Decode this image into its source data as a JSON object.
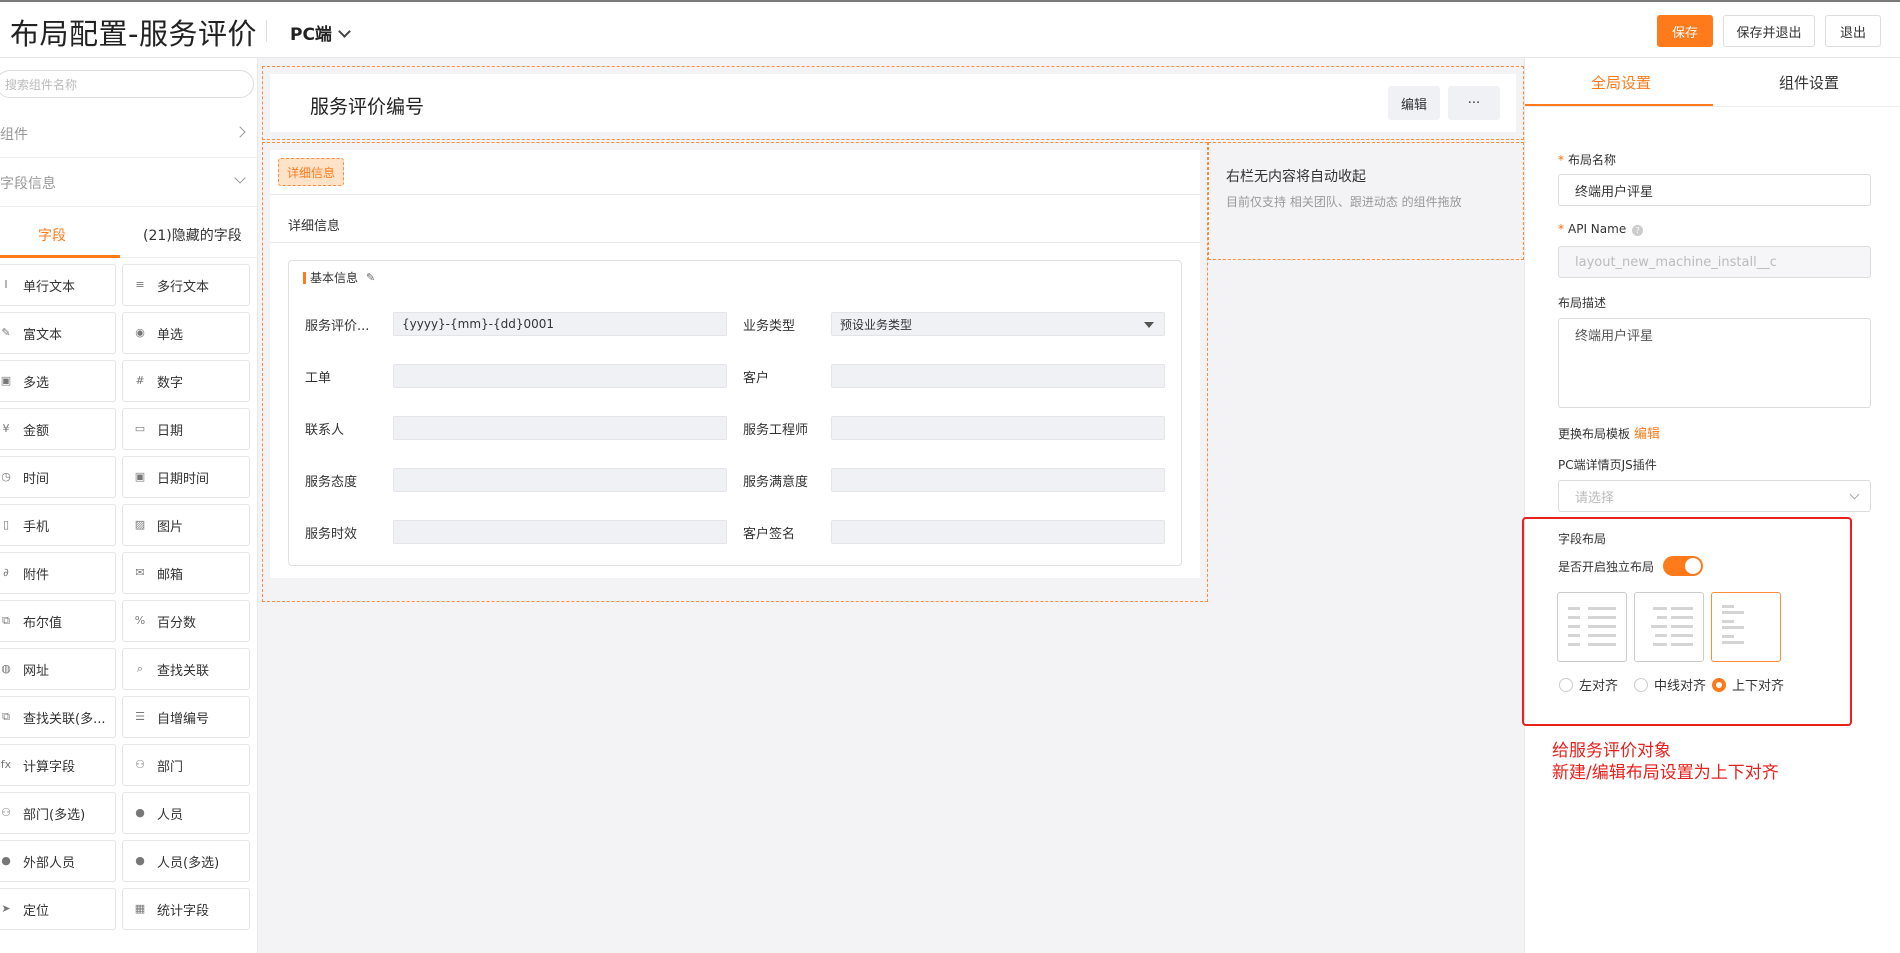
{
  "header": {
    "title": "布局配置-服务评价",
    "platform": "PC端",
    "save_label": "保存",
    "save_exit_label": "保存并退出",
    "exit_label": "退出"
  },
  "left": {
    "search_placeholder": "搜索组件名称",
    "components_label": "组件",
    "field_info_label": "字段信息",
    "tab_fields": "字段",
    "tab_hidden": "(21)隐藏的字段",
    "fields": [
      {
        "label": "单行文本",
        "icon": "text-icon"
      },
      {
        "label": "多行文本",
        "icon": "multiline-icon"
      },
      {
        "label": "富文本",
        "icon": "rich-text-icon"
      },
      {
        "label": "单选",
        "icon": "radio-icon"
      },
      {
        "label": "多选",
        "icon": "checkbox-icon"
      },
      {
        "label": "数字",
        "icon": "hash-icon"
      },
      {
        "label": "金额",
        "icon": "yen-icon"
      },
      {
        "label": "日期",
        "icon": "calendar-icon"
      },
      {
        "label": "时间",
        "icon": "clock-icon"
      },
      {
        "label": "日期时间",
        "icon": "datetime-icon"
      },
      {
        "label": "手机",
        "icon": "phone-icon"
      },
      {
        "label": "图片",
        "icon": "image-icon"
      },
      {
        "label": "附件",
        "icon": "paperclip-icon"
      },
      {
        "label": "邮箱",
        "icon": "mail-icon"
      },
      {
        "label": "布尔值",
        "icon": "boolean-icon"
      },
      {
        "label": "百分数",
        "icon": "percent-icon"
      },
      {
        "label": "网址",
        "icon": "globe-icon"
      },
      {
        "label": "查找关联",
        "icon": "lookup-icon"
      },
      {
        "label": "查找关联(多...",
        "icon": "lookup-multi-icon"
      },
      {
        "label": "自增编号",
        "icon": "list-number-icon"
      },
      {
        "label": "计算字段",
        "icon": "fx-icon"
      },
      {
        "label": "部门",
        "icon": "department-icon"
      },
      {
        "label": "部门(多选)",
        "icon": "department-multi-icon"
      },
      {
        "label": "人员",
        "icon": "person-icon"
      },
      {
        "label": "外部人员",
        "icon": "external-person-icon"
      },
      {
        "label": "人员(多选)",
        "icon": "person-multi-icon"
      },
      {
        "label": "定位",
        "icon": "location-icon"
      },
      {
        "label": "统计字段",
        "icon": "stats-icon"
      }
    ]
  },
  "canvas": {
    "object_title": "服务评价编号",
    "edit_label": "编辑",
    "more_label": "···",
    "detail_tag": "详细信息",
    "detail_sub": "详细信息",
    "group_title": "基本信息",
    "right_empty_title": "右栏无内容将自动收起",
    "right_empty_desc": "目前仅支持 相关团队、跟进动态 的组件拖放",
    "rows": [
      {
        "l_label": "服务评价...",
        "l_value": "{yyyy}-{mm}-{dd}0001",
        "r_label": "业务类型",
        "r_value": "预设业务类型"
      },
      {
        "l_label": "工单",
        "l_value": "",
        "r_label": "客户",
        "r_value": ""
      },
      {
        "l_label": "联系人",
        "l_value": "",
        "r_label": "服务工程师",
        "r_value": ""
      },
      {
        "l_label": "服务态度",
        "l_value": "",
        "r_label": "服务满意度",
        "r_value": ""
      },
      {
        "l_label": "服务时效",
        "l_value": "",
        "r_label": "客户签名",
        "r_value": ""
      }
    ]
  },
  "right": {
    "tab_global": "全局设置",
    "tab_component": "组件设置",
    "layout_name_label": "布局名称",
    "layout_name_value": "终端用户评星",
    "api_name_label": "API Name",
    "api_name_value": "layout_new_machine_install__c",
    "desc_label": "布局描述",
    "desc_value": "终端用户评星",
    "template_label": "更换布局模板",
    "template_edit": "编辑",
    "js_plugin_label": "PC端详情页JS插件",
    "js_plugin_placeholder": "请选择",
    "field_layout_label": "字段布局",
    "independent_label": "是否开启独立布局",
    "independent_on": true,
    "align_left": "左对齐",
    "align_center": "中线对齐",
    "align_top": "上下对齐",
    "selected_align": "上下对齐"
  },
  "annotation": {
    "line1": "给服务评价对象",
    "line2": "新建/编辑布局设置为上下对齐"
  },
  "colors": {
    "accent": "#ff7a1a",
    "annotation_red": "#e8211c"
  }
}
